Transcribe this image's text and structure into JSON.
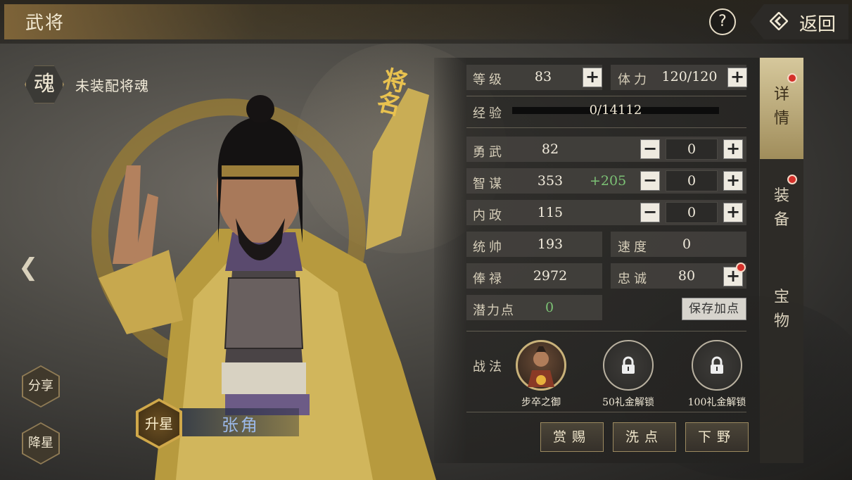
{
  "header": {
    "title": "武将",
    "help": "?",
    "back": "返回"
  },
  "soul": {
    "icon_char": "魂",
    "label": "未装配将魂"
  },
  "general": {
    "name_badge": [
      "将",
      "名"
    ],
    "name": "张角"
  },
  "left_buttons": {
    "share": "分享",
    "demote": "降星",
    "promote": "升星"
  },
  "tabs": [
    {
      "label": "详情",
      "active": true,
      "dot": true
    },
    {
      "label": "装备",
      "active": false,
      "dot": true
    },
    {
      "label": "宝物",
      "active": false,
      "dot": false
    }
  ],
  "stats": {
    "level": {
      "label": "等级",
      "value": "83"
    },
    "stamina": {
      "label": "体力",
      "value": "120/120"
    },
    "exp": {
      "label": "经验",
      "value": "0/14112",
      "progress": 0.0
    },
    "valor": {
      "label": "勇武",
      "value": "82",
      "add": "0"
    },
    "intellect": {
      "label": "智谋",
      "value": "353",
      "bonus": "+205",
      "add": "0"
    },
    "politics": {
      "label": "内政",
      "value": "115",
      "add": "0"
    },
    "command": {
      "label": "统帅",
      "value": "193"
    },
    "speed": {
      "label": "速度",
      "value": "0"
    },
    "salary": {
      "label": "俸禄",
      "value": "2972"
    },
    "loyalty": {
      "label": "忠诚",
      "value": "80"
    },
    "potential": {
      "label": "潜力点",
      "value": "0"
    }
  },
  "save_points": "保存加点",
  "tactics": {
    "label": "战法",
    "slots": [
      {
        "caption": "步卒之御",
        "locked": false
      },
      {
        "caption": "50礼金解锁",
        "locked": true
      },
      {
        "caption": "100礼金解锁",
        "locked": true
      }
    ]
  },
  "actions": {
    "reward": "赏赐",
    "reset": "洗点",
    "dismiss": "下野"
  },
  "colors": {
    "gold": "#e9c24f",
    "bonus_green": "#7cc275",
    "red_dot": "#d4302a",
    "name_blue": "#9bb8e8"
  }
}
